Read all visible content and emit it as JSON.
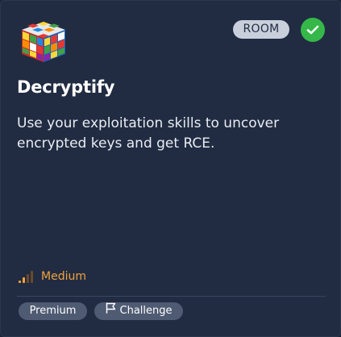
{
  "card": {
    "badge_label": "ROOM",
    "completed_icon": "checkmark-icon",
    "logo_icon": "rubiks-cube-icon",
    "title": "Decryptify",
    "description": "Use your exploitation skills to uncover encrypted keys and get RCE.",
    "difficulty": {
      "icon": "signal-bars-icon",
      "label": "Medium",
      "level_fraction": 0.5,
      "color": "#f2a23e"
    },
    "tags": [
      {
        "label": "Premium"
      },
      {
        "label": "Challenge",
        "icon": "flag-icon"
      }
    ],
    "colors": {
      "background": "#212c42",
      "completed": "#36b749",
      "badge": "#c9d0dc",
      "tag": "#4e5b72"
    }
  }
}
